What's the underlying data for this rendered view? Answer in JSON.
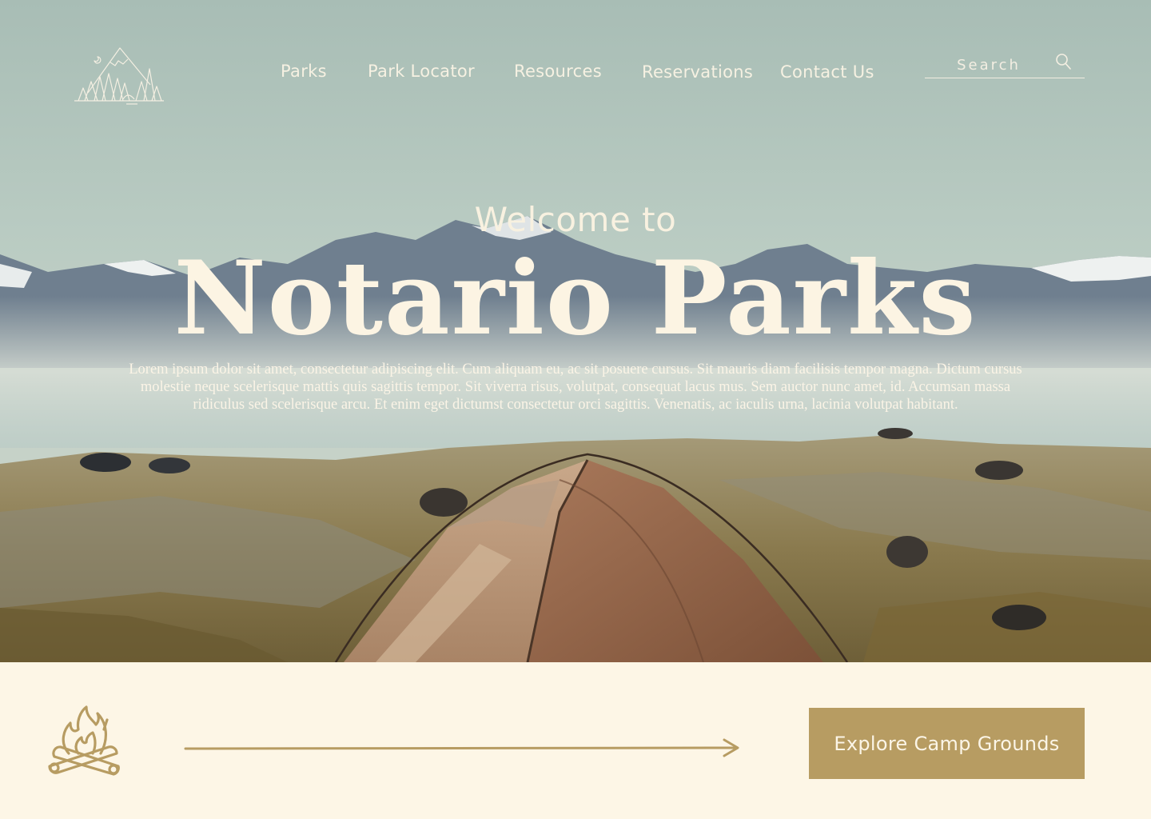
{
  "nav": {
    "items": [
      "Parks",
      "Park Locator",
      "Resources",
      "Reservations",
      "Contact Us"
    ]
  },
  "search": {
    "placeholder": "Search"
  },
  "hero": {
    "welcome": "Welcome to",
    "title": "Notario Parks",
    "description": "Lorem ipsum dolor sit amet, consectetur adipiscing elit. Cum aliquam eu, ac sit posuere cursus. Sit mauris diam facilisis tempor magna. Dictum cursus molestie neque scelerisque mattis quis sagittis tempor. Sit viverra risus, volutpat, consequat lacus mus. Sem auctor nunc amet, id. Accumsan massa ridiculus sed scelerisque arcu. Et enim eget dictumst consectetur orci sagittis. Venenatis, ac iaculis urna, lacinia volutpat habitant."
  },
  "cta": {
    "label": "Explore Camp Grounds"
  },
  "icons": {
    "logo": "mountain-forest-logo",
    "search": "search-icon",
    "campfire": "campfire-icon",
    "arrow": "arrow-right-icon"
  },
  "colors": {
    "accent": "#b79c62",
    "cream": "#fdf6e6",
    "hero_text": "#fcf4e3"
  }
}
